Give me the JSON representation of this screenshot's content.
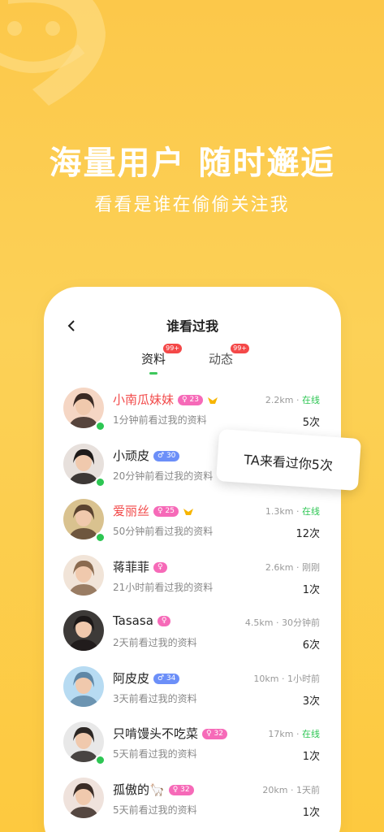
{
  "hero": {
    "title": "海量用户  随时邂逅",
    "subtitle": "看看是谁在偷偷关注我"
  },
  "colors": {
    "background": "#fcc84a",
    "online": "#2dc653",
    "vip_name": "#f24a4a",
    "female_badge": "#f66ab8",
    "male_badge": "#6c8ff8",
    "tab_indicator": "#3ec85c"
  },
  "screen": {
    "back_icon": "chevron-left-icon",
    "title": "谁看过我",
    "tabs": [
      {
        "label": "资料",
        "badge": "99+",
        "active": true
      },
      {
        "label": "动态",
        "badge": "99+",
        "active": false
      }
    ]
  },
  "visitors": [
    {
      "name": "小南瓜妹妹",
      "gender": "female",
      "age": "23",
      "vip": true,
      "online": true,
      "distance": "2.2km",
      "status": "在线",
      "desc": "1分钟前看过我的资料",
      "count": "5次"
    },
    {
      "name": "小顽皮",
      "gender": "male",
      "age": "30",
      "vip": false,
      "online": true,
      "distance": "",
      "status": "",
      "desc": "20分钟前看过我的资料",
      "count": ""
    },
    {
      "name": "爱丽丝",
      "gender": "female",
      "age": "25",
      "vip": true,
      "online": true,
      "distance": "1.3km",
      "status": "在线",
      "desc": "50分钟前看过我的资料",
      "count": "12次"
    },
    {
      "name": "蒋菲菲",
      "gender": "female",
      "age": "",
      "vip": false,
      "online": false,
      "distance": "2.6km",
      "status": "刚刚",
      "desc": "21小时前看过我的资料",
      "count": "1次"
    },
    {
      "name": "Tasasa",
      "gender": "female",
      "age": "",
      "vip": false,
      "online": false,
      "distance": "4.5km",
      "status": "30分钟前",
      "desc": "2天前看过我的资料",
      "count": "6次"
    },
    {
      "name": "阿皮皮",
      "gender": "male",
      "age": "34",
      "vip": false,
      "online": false,
      "distance": "10km",
      "status": "1小时前",
      "desc": "3天前看过我的资料",
      "count": "3次"
    },
    {
      "name": "只啃馒头不吃菜",
      "gender": "female",
      "age": "32",
      "vip": false,
      "online": true,
      "distance": "17km",
      "status": "在线",
      "desc": "5天前看过我的资料",
      "count": "1次"
    },
    {
      "name": "孤傲的🦙",
      "gender": "female",
      "age": "32",
      "vip": false,
      "online": false,
      "distance": "20km",
      "status": "1天前",
      "desc": "5天前看过我的资料",
      "count": "1次"
    }
  ],
  "tooltip": {
    "text": "TA来看过你5次"
  }
}
